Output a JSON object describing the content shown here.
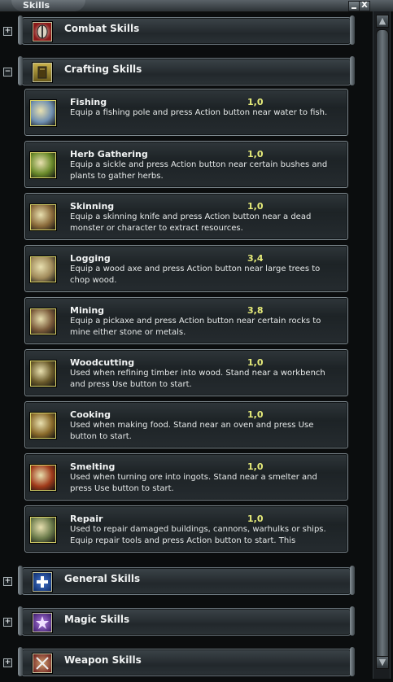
{
  "window": {
    "title": "Skills",
    "minimize_label": "",
    "close_label": "X"
  },
  "scrollbar": {
    "up_arrow": "▲",
    "down_arrow": "▼"
  },
  "categories": {
    "combat": {
      "label": "Combat Skills",
      "expander": "+",
      "icon": "shield-icon"
    },
    "crafting": {
      "label": "Crafting Skills",
      "expander": "−",
      "icon": "book-icon"
    },
    "general": {
      "label": "General Skills",
      "expander": "+",
      "icon": "cross-icon"
    },
    "magic": {
      "label": "Magic Skills",
      "expander": "+",
      "icon": "star-icon"
    },
    "weapon": {
      "label": "Weapon Skills",
      "expander": "+",
      "icon": "crossed-swords-icon"
    }
  },
  "skills": [
    {
      "name": "Fishing",
      "value": "1,0",
      "desc": "Equip a fishing pole and press Action button near water to fish.",
      "icon": "fish-icon",
      "color": "#6f8fb0"
    },
    {
      "name": "Herb Gathering",
      "value": "1,0",
      "desc": "Equip a sickle and press Action button near certain bushes and plants to gather herbs.",
      "icon": "herb-icon",
      "color": "#6a8a2a"
    },
    {
      "name": "Skinning",
      "value": "1,0",
      "desc": "Equip a skinning knife and press Action button near a dead monster or character to extract resources.",
      "icon": "hide-icon",
      "color": "#8a6a3a"
    },
    {
      "name": "Logging",
      "value": "3,4",
      "desc": "Equip a wood axe and press Action button near large trees to chop wood.",
      "icon": "logs-icon",
      "color": "#a08a5a"
    },
    {
      "name": "Mining",
      "value": "3,8",
      "desc": "Equip a pickaxe and press Action button near certain rocks to mine either stone or metals.",
      "icon": "pickaxe-icon",
      "color": "#7a5a3a"
    },
    {
      "name": "Woodcutting",
      "value": "1,0",
      "desc": "Used when refining timber into wood. Stand near a workbench and press Use button to start.",
      "icon": "saw-icon",
      "color": "#6a5a2a"
    },
    {
      "name": "Cooking",
      "value": "1,0",
      "desc": "Used when making food. Stand near an oven and press Use button to start.",
      "icon": "pot-icon",
      "color": "#8a6a2a"
    },
    {
      "name": "Smelting",
      "value": "1,0",
      "desc": "Used when turning ore into ingots. Stand near a smelter and press Use button to start.",
      "icon": "furnace-icon",
      "color": "#a03a1a"
    },
    {
      "name": "Repair",
      "value": "1,0",
      "desc": "Used to repair damaged buildings, cannons, warhulks or ships. Equip repair tools and press Action button to start. This",
      "icon": "hammer-icon",
      "color": "#6a7a4a"
    }
  ]
}
